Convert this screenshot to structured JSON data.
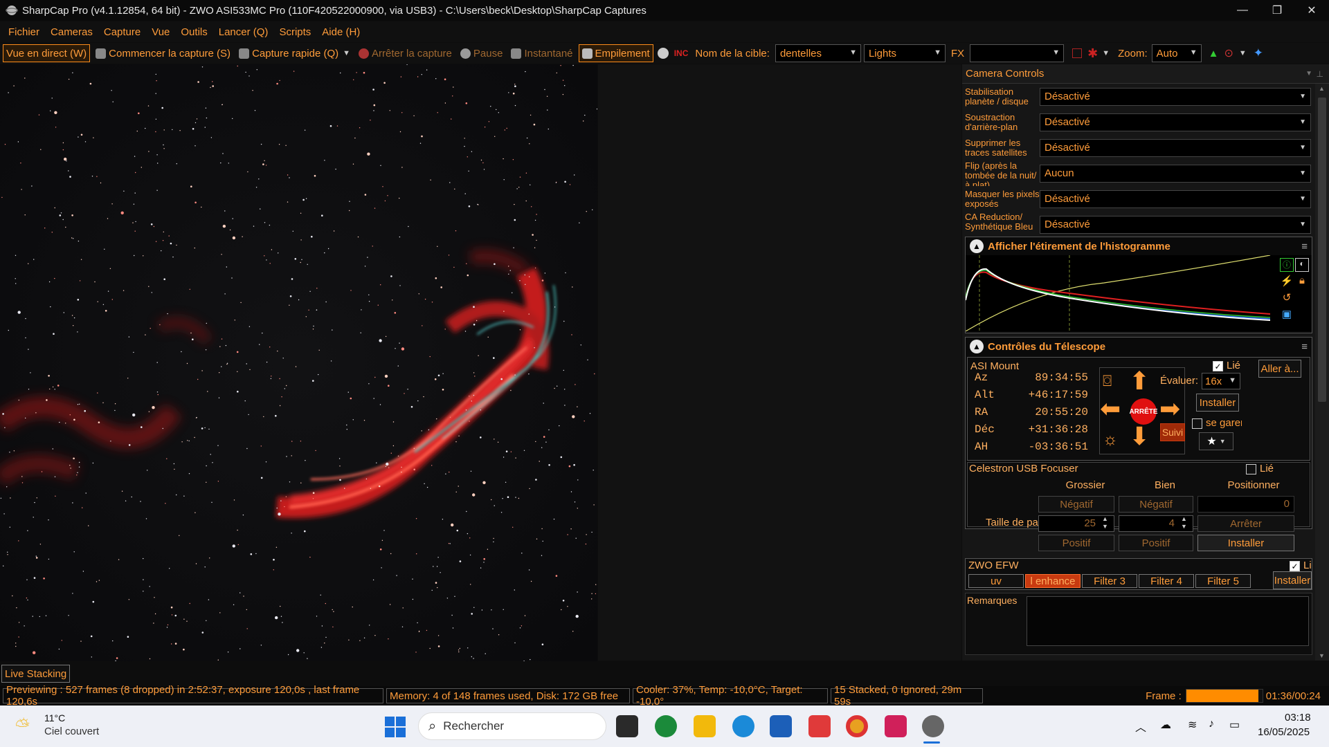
{
  "window": {
    "title": "SharpCap Pro (v4.1.12854, 64 bit) - ZWO ASI533MC Pro (110F420522000900, via USB3) - C:\\Users\\beck\\Desktop\\SharpCap Captures",
    "min": "—",
    "max": "❐",
    "close": "✕"
  },
  "menu": [
    "Fichier",
    "Cameras",
    "Capture",
    "Vue",
    "Outils",
    "Lancer (Q)",
    "Scripts",
    "Aide (H)"
  ],
  "toolbar": {
    "live": "Vue en direct (W)",
    "start": "Commencer la capture (S)",
    "quick": "Capture rapide (Q)",
    "stop": "Arrêter la capture",
    "pause": "Pause",
    "snapshot": "Instantané",
    "stack": "Empilement",
    "target_label": "Nom de la cible:",
    "target_value": "dentelles",
    "frame_type": "Lights",
    "fx": "FX",
    "fx_value": "",
    "zoom_label": "Zoom:",
    "zoom_value": "Auto"
  },
  "camera_controls": {
    "title": "Camera Controls",
    "rows": [
      {
        "label": "Stabilisation planète / disque",
        "value": "Désactivé"
      },
      {
        "label": "Soustraction d'arrière-plan",
        "value": "Désactivé"
      },
      {
        "label": "Supprimer les traces satellites",
        "value": "Désactivé"
      },
      {
        "label": "Flip (après la tombée de la nuit/à plat)",
        "value": "Aucun"
      },
      {
        "label": "Masquer les pixels exposés",
        "value": "Désactivé"
      },
      {
        "label": "CA Reduction/ Synthétique Bleu",
        "value": "Désactivé"
      }
    ]
  },
  "histogram": {
    "title": "Afficher l'étirement de l'histogramme"
  },
  "telescope": {
    "title": "Contrôles du Télescope",
    "mount": "ASI Mount",
    "linked_label": "Lié",
    "goto": "Aller à...",
    "coords": [
      {
        "k": "Az",
        "v": "89:34:55"
      },
      {
        "k": "Alt",
        "v": "+46:17:59"
      },
      {
        "k": "RA",
        "v": "20:55:20"
      },
      {
        "k": "Déc",
        "v": "+31:36:28"
      },
      {
        "k": "AH",
        "v": "-03:36:51"
      }
    ],
    "rate_label": "Évaluer:",
    "rate_value": "16x",
    "install": "Installer",
    "park": "se garer",
    "stop": "ARRÊTE",
    "track": "Suivi"
  },
  "focuser": {
    "title": "Celestron USB Focuser",
    "linked_label": "Lié",
    "col_coarse": "Grossier",
    "col_fine": "Bien",
    "col_pos": "Positionner",
    "neg": "Négatif",
    "pos": "Positif",
    "step_label": "Taille de pas",
    "coarse_step": "25",
    "fine_step": "4",
    "position": "0",
    "stop": "Arrêter",
    "install": "Installer"
  },
  "efw": {
    "title": "ZWO EFW",
    "linked_label": "Lié",
    "filters": [
      "uv",
      "l enhance",
      "Filter 3",
      "Filter 4",
      "Filter 5"
    ],
    "active": 1,
    "install": "Installer"
  },
  "notes": {
    "label": "Remarques"
  },
  "live_stacking_tab": "Live Stacking",
  "status": {
    "preview": "Previewing : 527 frames (8 dropped) in 2:52:37, exposure 120,0s , last frame 120,6s",
    "memory": "Memory: 4 of 148 frames used, Disk: 172 GB free",
    "cooler": "Cooler: 37%, Temp: -10,0°C, Target: -10,0°",
    "stacked": "15 Stacked, 0 Ignored, 29m 59s",
    "frame_label": "Frame :",
    "frame_progress": 0.95,
    "frame_time": "01:36/00:24"
  },
  "taskbar": {
    "temp": "11°C",
    "weather": "Ciel couvert",
    "search": "Rechercher",
    "time": "03:18",
    "date": "16/05/2025"
  },
  "colors": {
    "accent": "#ff9c3a",
    "active_filter": "#c83a10",
    "progress": "#ff8c00"
  }
}
